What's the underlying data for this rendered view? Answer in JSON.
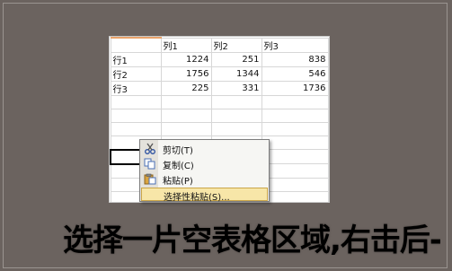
{
  "spreadsheet": {
    "columns": [
      "",
      "列1",
      "列2",
      "列3"
    ],
    "rows": [
      {
        "label": "行1",
        "values": [
          "1224",
          "251",
          "838"
        ]
      },
      {
        "label": "行2",
        "values": [
          "1756",
          "1344",
          "546"
        ]
      },
      {
        "label": "行3",
        "values": [
          "225",
          "331",
          "1736"
        ]
      }
    ]
  },
  "context_menu": {
    "items": [
      {
        "label": "剪切(T)",
        "icon": "scissors-icon"
      },
      {
        "label": "复制(C)",
        "icon": "copy-icon"
      },
      {
        "label": "粘贴(P)",
        "icon": "clipboard-paste-icon"
      },
      {
        "label": "选择性粘贴(S)...",
        "icon": ""
      }
    ],
    "highlighted_item": "选择性粘贴(S)..."
  },
  "caption": {
    "text": "选择一片空表格区域,右击后-"
  },
  "colors": {
    "background": "#6b635f",
    "menu_highlight": "#f7e6a8"
  }
}
